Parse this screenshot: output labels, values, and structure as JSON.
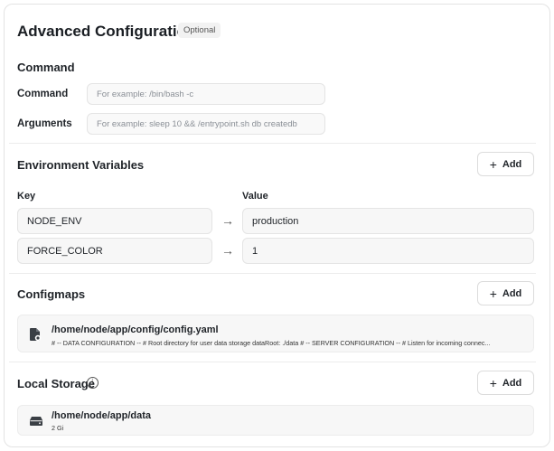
{
  "header": {
    "title": "Advanced Configuration",
    "badge": "Optional"
  },
  "command_section": {
    "title": "Command",
    "command_label": "Command",
    "command_placeholder": "For example:  /bin/bash -c",
    "arguments_label": "Arguments",
    "arguments_placeholder": "For example:  sleep 10 && /entrypoint.sh db createdb"
  },
  "env_section": {
    "title": "Environment Variables",
    "add_label": "Add",
    "key_header": "Key",
    "value_header": "Value",
    "rows": [
      {
        "key": "NODE_ENV",
        "value": "production"
      },
      {
        "key": "FORCE_COLOR",
        "value": "1"
      }
    ]
  },
  "configmaps_section": {
    "title": "Configmaps",
    "add_label": "Add",
    "items": [
      {
        "path": "/home/node/app/config/config.yaml",
        "preview": "# -- DATA CONFIGURATION -- # Root directory for user data storage dataRoot: ./data # -- SERVER CONFIGURATION -- # Listen for incoming connec..."
      }
    ]
  },
  "storage_section": {
    "title": "Local Storage",
    "info_icon": "info-icon",
    "add_label": "Add",
    "items": [
      {
        "path": "/home/node/app/data",
        "size": "2 Gi"
      }
    ]
  }
}
